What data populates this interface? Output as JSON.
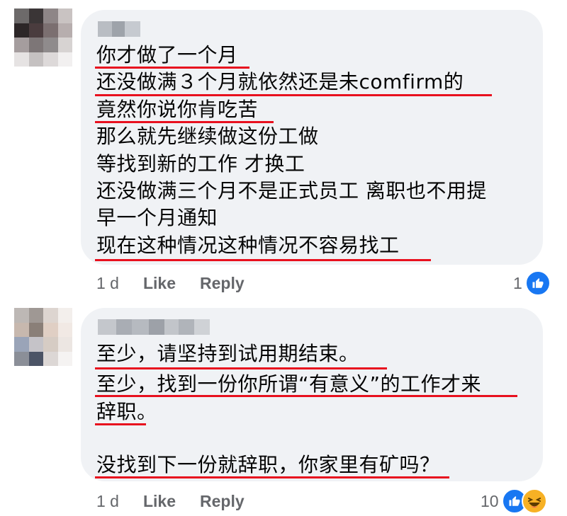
{
  "colors": {
    "underline": "#e8101e",
    "bubble": "#f0f2f5",
    "like_blue": "#1877f2",
    "haha_yellow": "#f7b125"
  },
  "comments": [
    {
      "author": "",
      "lines": [
        "你才做了一个月",
        "还没做满３个月就依然还是未comfirm的",
        "竟然你说你肯吃苦",
        "那么就先继续做这份工做",
        "等找到新的工作 才换工",
        "还没做满三个月不是正式员工 离职也不用提",
        "早一个月通知",
        "现在这种情况这种情况不容易找工"
      ],
      "timestamp": "1 d",
      "like_label": "Like",
      "reply_label": "Reply",
      "reaction_count": "1",
      "reaction_icons": [
        "like-icon"
      ]
    },
    {
      "author": "",
      "lines": [
        "至少，请坚持到试用期结束。",
        "至少，找到一份你所谓“有意义”的工作才来",
        "辞职。",
        "",
        "没找到下一份就辞职，你家里有矿吗？"
      ],
      "timestamp": "1 d",
      "like_label": "Like",
      "reply_label": "Reply",
      "reaction_count": "10",
      "reaction_icons": [
        "like-icon",
        "haha-icon"
      ]
    }
  ]
}
